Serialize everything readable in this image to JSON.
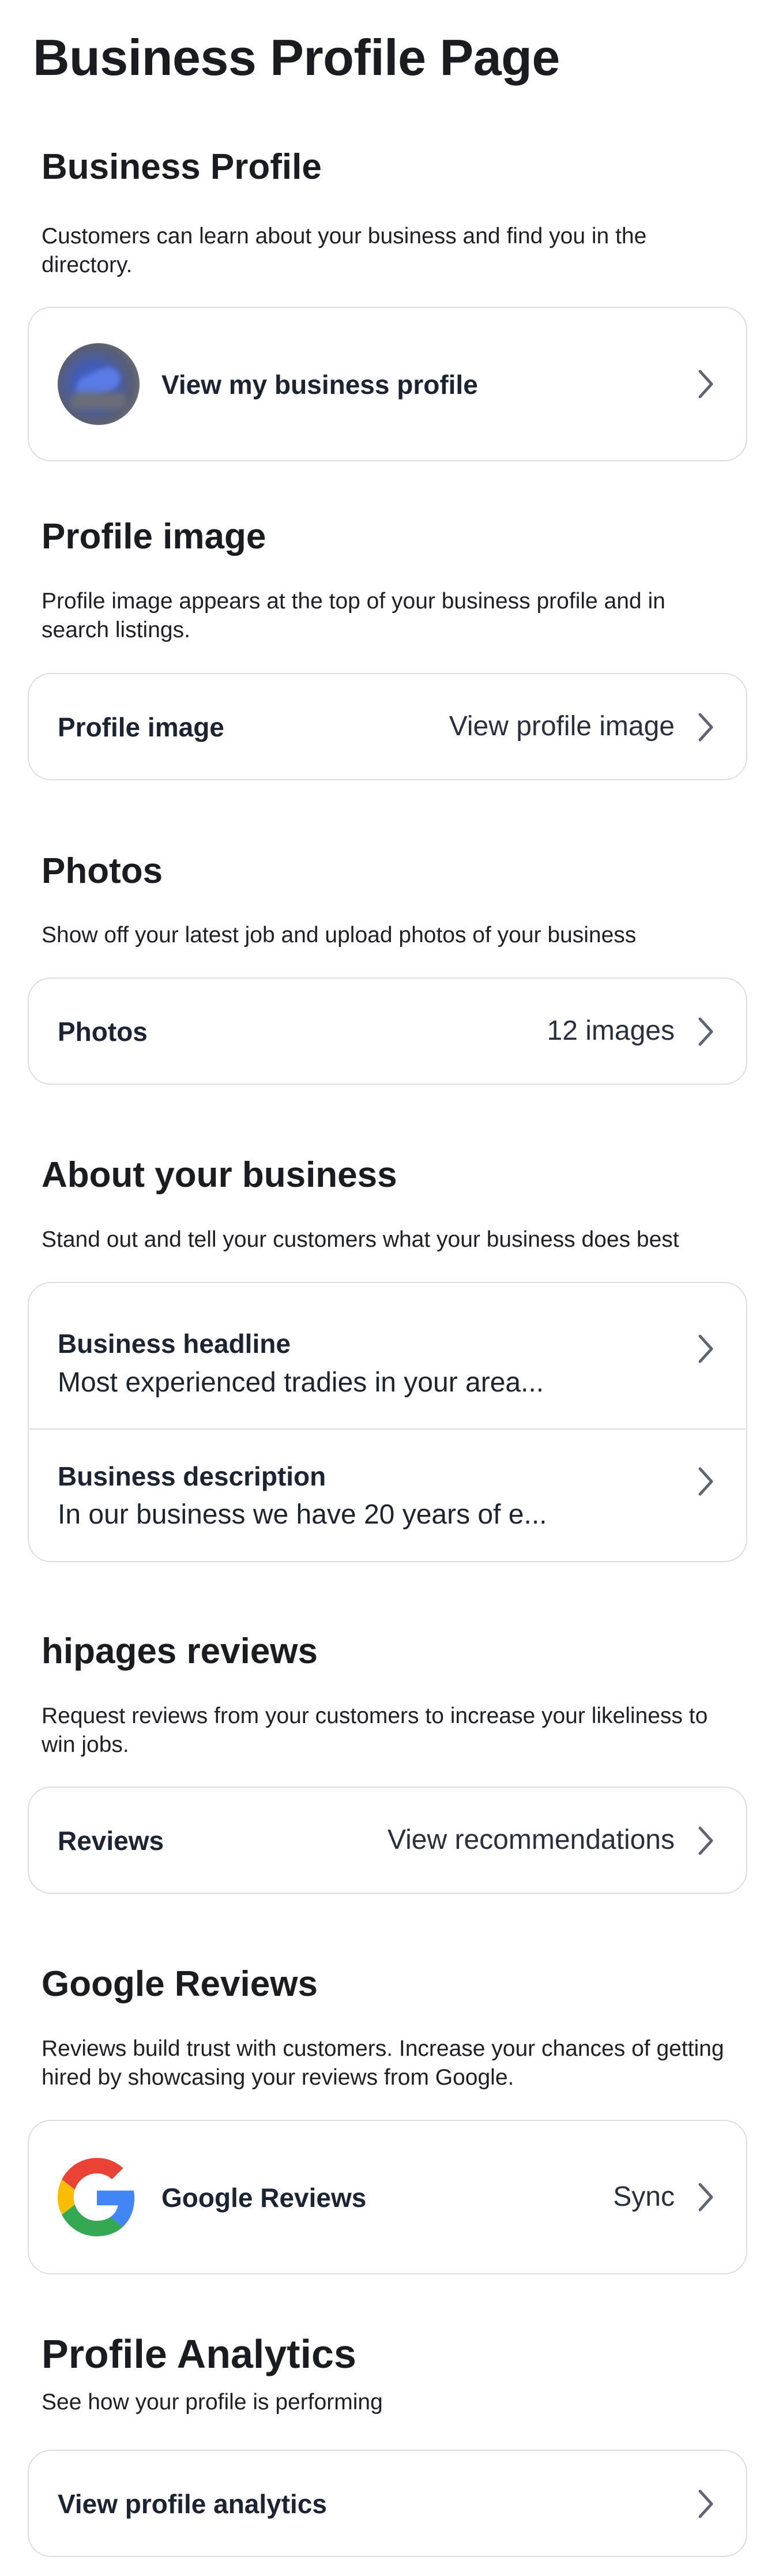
{
  "page": {
    "title": "Business Profile Page"
  },
  "business_profile": {
    "title": "Business Profile",
    "description": "Customers can learn about your business and find you in the directory.",
    "link_label": "View my business profile"
  },
  "profile_image": {
    "title": "Profile image",
    "description": "Profile image appears at the top of your business profile and in search listings.",
    "row_label": "Profile image",
    "row_value": "View profile image"
  },
  "photos": {
    "title": "Photos",
    "description": "Show off your latest job and upload photos of your business",
    "row_label": "Photos",
    "row_value": "12 images"
  },
  "about": {
    "title": "About your business",
    "description": "Stand out and tell your customers what your business does best",
    "headline_label": "Business headline",
    "headline_value": "Most experienced tradies in your area...",
    "description_label": "Business description",
    "description_value": "In our business we have 20 years of e..."
  },
  "hipages_reviews": {
    "title": "hipages reviews",
    "description": "Request reviews from your customers to increase your likeliness to win jobs.",
    "row_label": "Reviews",
    "row_value": "View recommendations"
  },
  "google_reviews": {
    "title": "Google Reviews",
    "description": "Reviews build trust with customers. Increase your chances of getting hired by showcasing your reviews from Google.",
    "row_label": "Google Reviews",
    "row_value": "Sync"
  },
  "analytics": {
    "title": "Profile Analytics",
    "description": "See how your profile is performing",
    "row_label": "View profile analytics"
  },
  "icons": {
    "chevron": "chevron-right-icon",
    "google": "google-logo-icon",
    "avatar": "business-avatar"
  },
  "colors": {
    "text_primary": "#1b1c20",
    "row_label": "#1c2333",
    "border": "#dcdde1",
    "chevron": "#5f6470"
  }
}
